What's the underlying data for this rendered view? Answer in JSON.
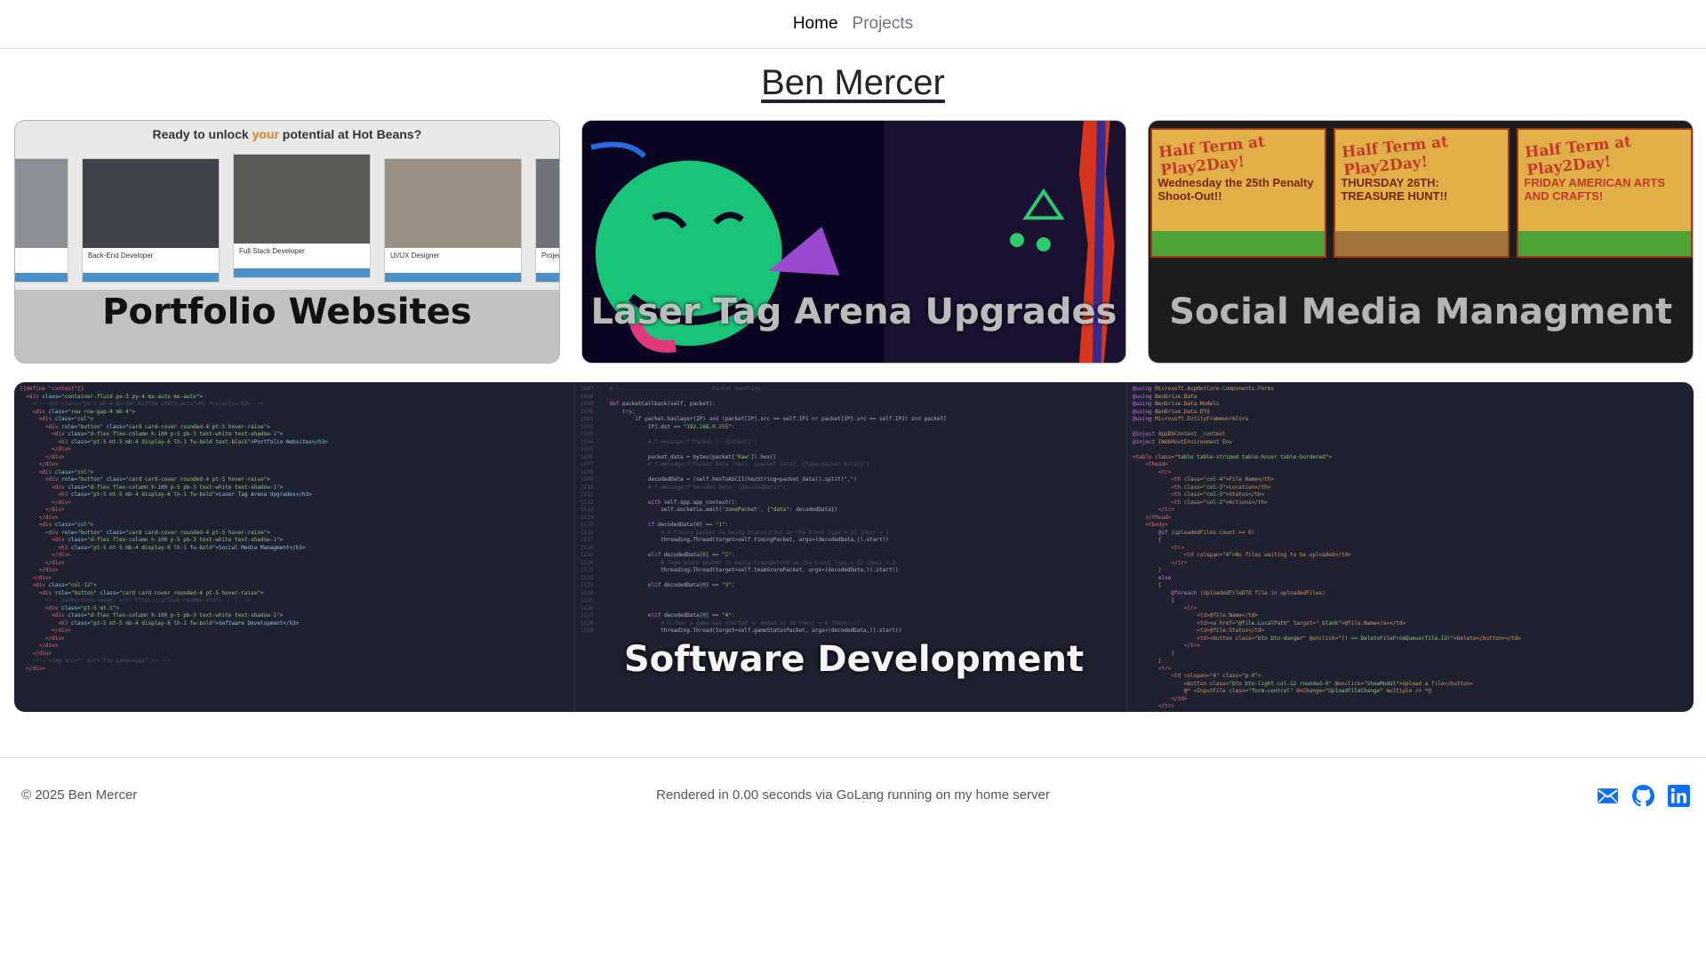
{
  "nav": {
    "home": "Home",
    "projects": "Projects"
  },
  "page": {
    "title": "Ben Mercer"
  },
  "cards": [
    {
      "title": "Portfolio Websites",
      "banner_pre": "Ready to unlock ",
      "banner_hl": "your",
      "banner_post": " potential at Hot Beans?",
      "thumbs": [
        "Back-End Developer",
        "Full Stack Developer",
        "UI/UX Designer",
        "Projec"
      ]
    },
    {
      "title": "Laser Tag Arena Upgrades"
    },
    {
      "title": "Social Media Managment",
      "posters": [
        {
          "head": "Half Term at Play2Day!",
          "text": "Wednesday the 25th Penalty Shoot-Out!!"
        },
        {
          "head": "Half Term at Play2Day!",
          "text": "THURSDAY 26TH: TREASURE HUNT!!"
        },
        {
          "head": "Half Term at Play2Day!",
          "text": "FRIDAY AMERICAN ARTS AND CRAFTS!"
        }
      ]
    },
    {
      "title": "Software Development"
    }
  ],
  "footer": {
    "copyright": "© 2025 Ben Mercer",
    "rendered": "Rendered in 0.00 seconds via GoLang running on my home server"
  },
  "icons": {
    "mail": "mail-icon",
    "github": "github-icon",
    "linkedin": "linkedin-icon"
  },
  "colors": {
    "link_icon": "#0d6efd",
    "banner_highlight": "#d9822b"
  }
}
